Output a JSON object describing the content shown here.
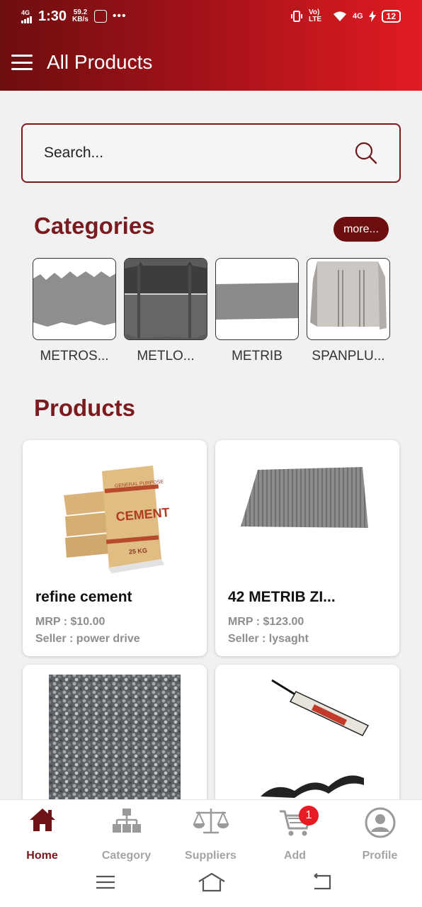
{
  "status_bar": {
    "network": "4G",
    "time": "1:30",
    "speed_value": "59.2",
    "speed_unit": "KB/s",
    "volte": "Vo) LTE",
    "network_right": "4G",
    "battery": "12"
  },
  "header": {
    "title": "All Products",
    "menu_icon": "hamburger-menu-icon"
  },
  "search": {
    "placeholder": "Search...",
    "value": "",
    "icon": "search-icon"
  },
  "categories": {
    "title": "Categories",
    "more_label": "more...",
    "items": [
      {
        "label": "METROS..."
      },
      {
        "label": "METLO..."
      },
      {
        "label": "METRIB"
      },
      {
        "label": "SPANPLU..."
      }
    ]
  },
  "products": {
    "title": "Products",
    "items": [
      {
        "name": "refine cement",
        "mrp": "MRP : $10.00",
        "seller": "Seller : power drive",
        "bag_top_text": "GENERAL PURPOSE",
        "bag_brand": "CEMENT",
        "bag_weight": "25 KG"
      },
      {
        "name": "42 METRIB ZI...",
        "mrp": "MRP : $123.00",
        "seller": "Seller : lysaght"
      },
      {
        "name": "",
        "mrp": "",
        "seller": ""
      },
      {
        "name": "",
        "mrp": "",
        "seller": ""
      }
    ]
  },
  "bottom_nav": {
    "items": [
      {
        "label": "Home",
        "icon": "home-icon",
        "active": true
      },
      {
        "label": "Category",
        "icon": "category-tree-icon",
        "active": false
      },
      {
        "label": "Suppliers",
        "icon": "scales-icon",
        "active": false
      },
      {
        "label": "Add",
        "icon": "cart-icon",
        "active": false,
        "badge": "1"
      },
      {
        "label": "Profile",
        "icon": "profile-icon",
        "active": false
      }
    ]
  },
  "colors": {
    "primary_dark": "#6d0e10",
    "primary_bright": "#e11b22",
    "section_title": "#7a1b1f",
    "badge": "#e51c23"
  }
}
